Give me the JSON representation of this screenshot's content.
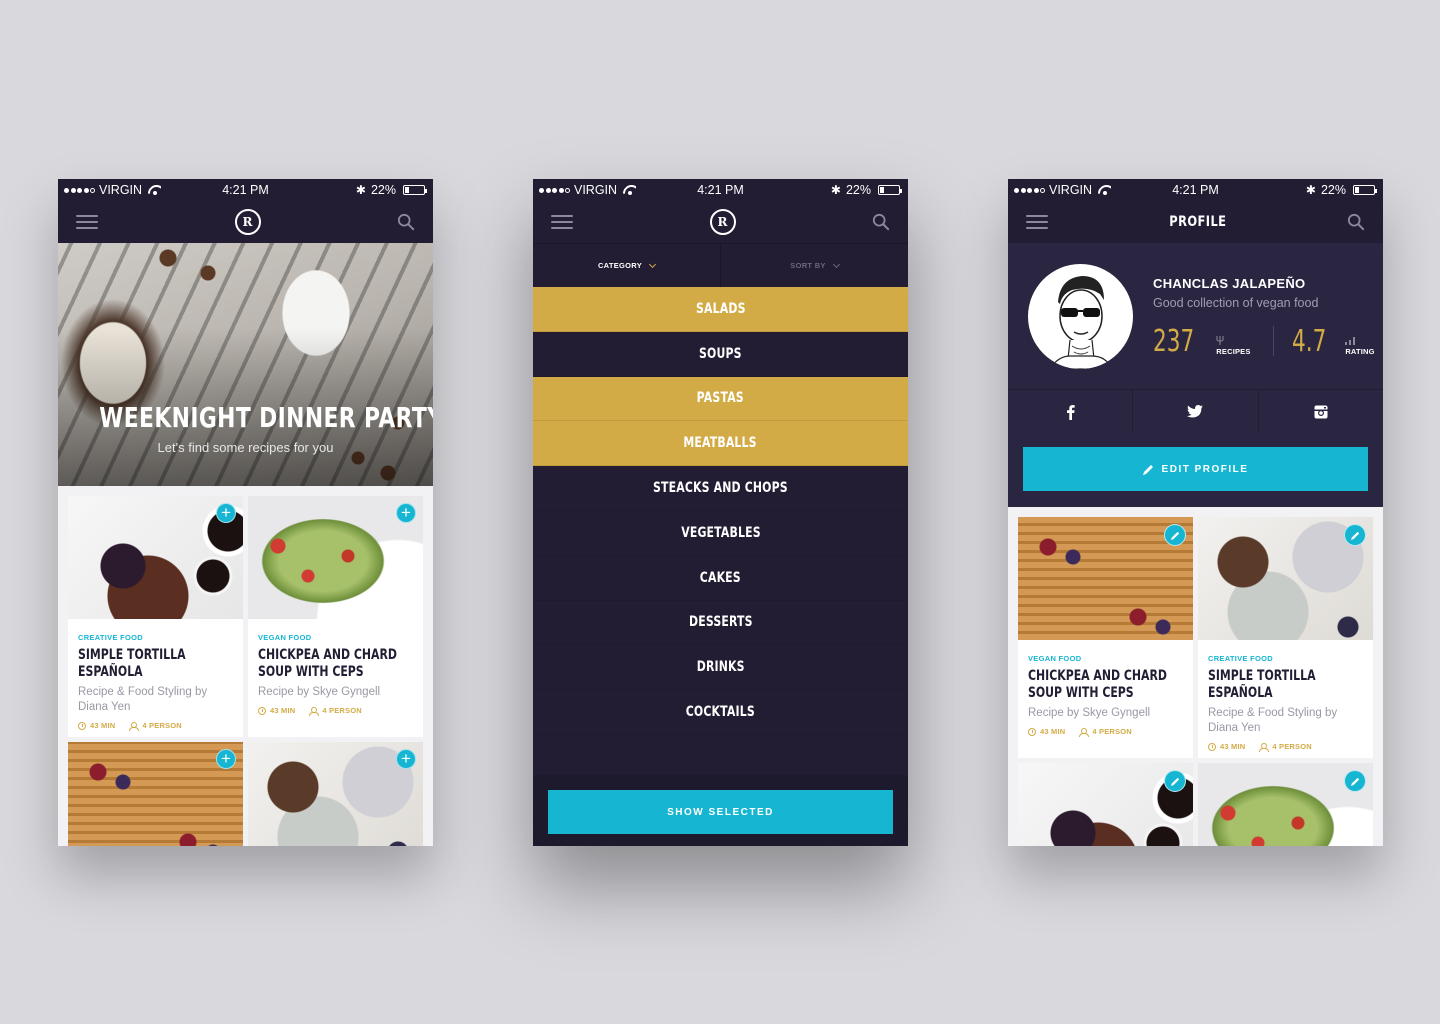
{
  "status": {
    "carrier": "VIRGIN",
    "time": "4:21 PM",
    "battery": "22%",
    "battery_level": 0.22
  },
  "phone1": {
    "hero": {
      "title": "WEEKNIGHT DINNER PARTY",
      "subtitle": "Let's find some recipes for you"
    },
    "cards": [
      {
        "category": "CREATIVE FOOD",
        "title": "SIMPLE TORTILLA ESPAÑOLA",
        "description": "Recipe & Food Styling by Diana Yen",
        "time": "43 MIN",
        "servings": "4 PERSON",
        "image": "cake-plate"
      },
      {
        "category": "VEGAN FOOD",
        "title": "CHICKPEA AND CHARD SOUP WITH CEPS",
        "description": "Recipe by Skye Gyngell",
        "time": "43 MIN",
        "servings": "4 PERSON",
        "image": "salad-plate"
      }
    ]
  },
  "phone2": {
    "filters": {
      "category": "CATEGORY",
      "sort": "SORT BY"
    },
    "categories": [
      {
        "label": "SALADS",
        "selected": true
      },
      {
        "label": "SOUPS",
        "selected": false
      },
      {
        "label": "PASTAS",
        "selected": true
      },
      {
        "label": "MEATBALLS",
        "selected": true
      },
      {
        "label": "STEACKS AND CHOPS",
        "selected": false
      },
      {
        "label": "VEGETABLES",
        "selected": false
      },
      {
        "label": "CAKES",
        "selected": false
      },
      {
        "label": "DESSERTS",
        "selected": false
      },
      {
        "label": "DRINKS",
        "selected": false
      },
      {
        "label": "COCKTAILS",
        "selected": false
      }
    ],
    "action": "SHOW SELECTED"
  },
  "phone3": {
    "title": "PROFILE",
    "profile": {
      "name": "CHANCLAS JALAPEÑO",
      "bio": "Good collection of vegan food",
      "recipes": "237",
      "recipes_label": "RECIPES",
      "rating": "4.7",
      "rating_label": "RATING"
    },
    "social": [
      "facebook-icon",
      "twitter-icon",
      "instagram-icon"
    ],
    "edit_label": "EDIT PROFILE",
    "cards": [
      {
        "category": "VEGAN FOOD",
        "title": "CHICKPEA AND CHARD SOUP WITH CEPS",
        "description": "Recipe by Skye Gyngell",
        "time": "43 MIN",
        "servings": "4 PERSON",
        "image": "waffle-plate"
      },
      {
        "category": "CREATIVE FOOD",
        "title": "SIMPLE TORTILLA ESPAÑOLA",
        "description": "Recipe & Food Styling by Diana Yen",
        "time": "43 MIN",
        "servings": "4 PERSON",
        "image": "fig-plate"
      }
    ]
  },
  "colors": {
    "navy": "#221d33",
    "gold": "#d3ab46",
    "cyan": "#16b6d3",
    "background": "#d8d8dd"
  }
}
